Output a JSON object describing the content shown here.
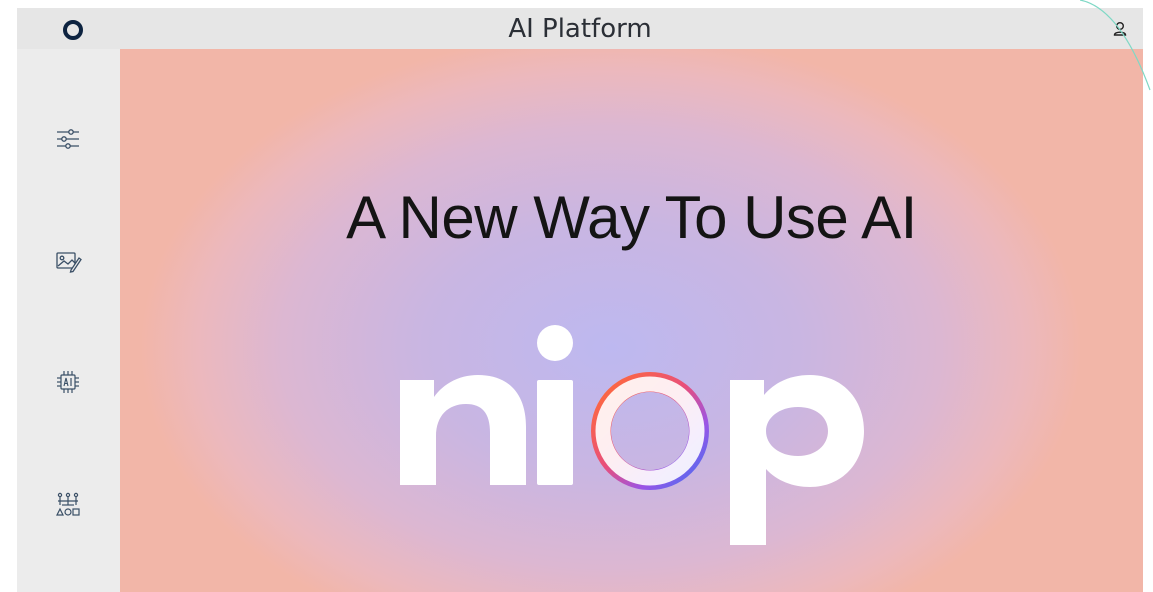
{
  "header": {
    "title": "AI Platform"
  },
  "sidebar": {
    "items": [
      {
        "icon": "sliders-icon"
      },
      {
        "icon": "image-edit-icon"
      },
      {
        "icon": "ai-chip-icon"
      },
      {
        "icon": "hierarchy-network-icon"
      }
    ]
  },
  "hero": {
    "headline": "A New Way To Use AI",
    "brand": "niop"
  },
  "colors": {
    "topbar": "#e6e6e6",
    "sidebar": "#ececec",
    "gradient_center": "#bdb8f0",
    "gradient_edge": "#f2b6a8",
    "logo": "#0d2340"
  }
}
